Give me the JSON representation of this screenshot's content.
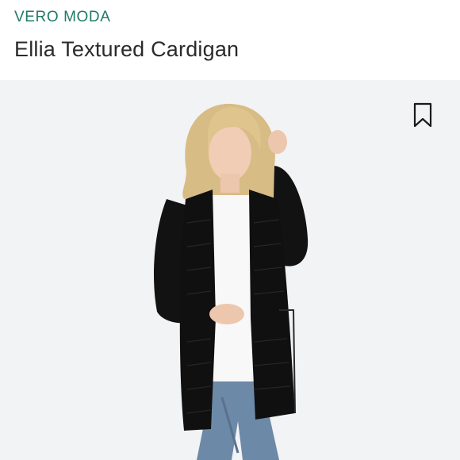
{
  "listing": {
    "brand": "VERO MODA",
    "title": "Ellia Textured Cardigan"
  },
  "image": {
    "subject": "product-photo-model-black-cardigan"
  },
  "actions": {
    "bookmark_icon": "bookmark-icon"
  },
  "colors": {
    "brand": "#1f7a66",
    "title": "#2a2a2a",
    "photo_background": "#f2f3f4",
    "cardigan": "#101010"
  }
}
